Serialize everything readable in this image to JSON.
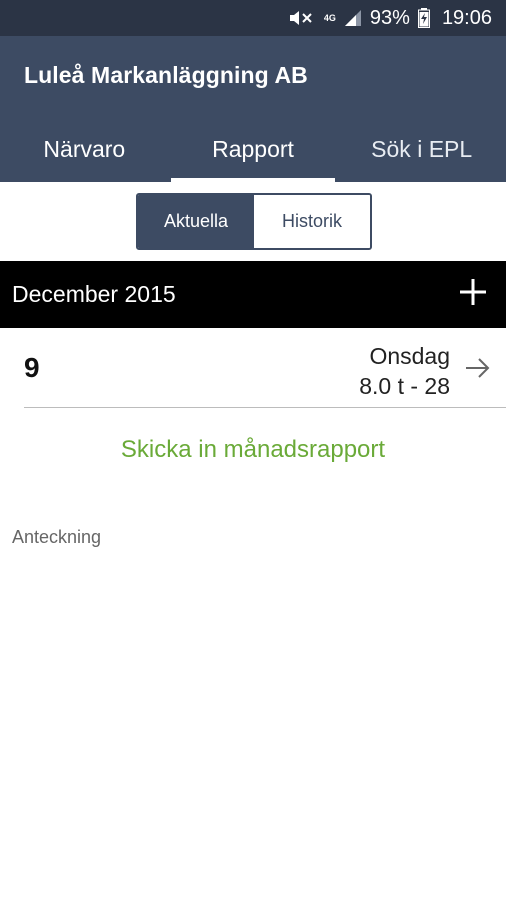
{
  "status_bar": {
    "network": "4G",
    "battery": "93%",
    "time": "19:06"
  },
  "app": {
    "title": "Luleå Markanläggning AB"
  },
  "tabs": [
    {
      "label": "Närvaro"
    },
    {
      "label": "Rapport"
    },
    {
      "label": "Sök i EPL"
    }
  ],
  "segments": {
    "current_label": "Aktuella",
    "history_label": "Historik"
  },
  "month": {
    "title": "December 2015"
  },
  "entry": {
    "day": "9",
    "weekday": "Onsdag",
    "summary": "8.0 t - 28"
  },
  "send_report_label": "Skicka in månadsrapport",
  "note_label": "Anteckning",
  "colors": {
    "header": "#3d4b63",
    "status_bar": "#2b3445",
    "link_green": "#6aaa38"
  }
}
